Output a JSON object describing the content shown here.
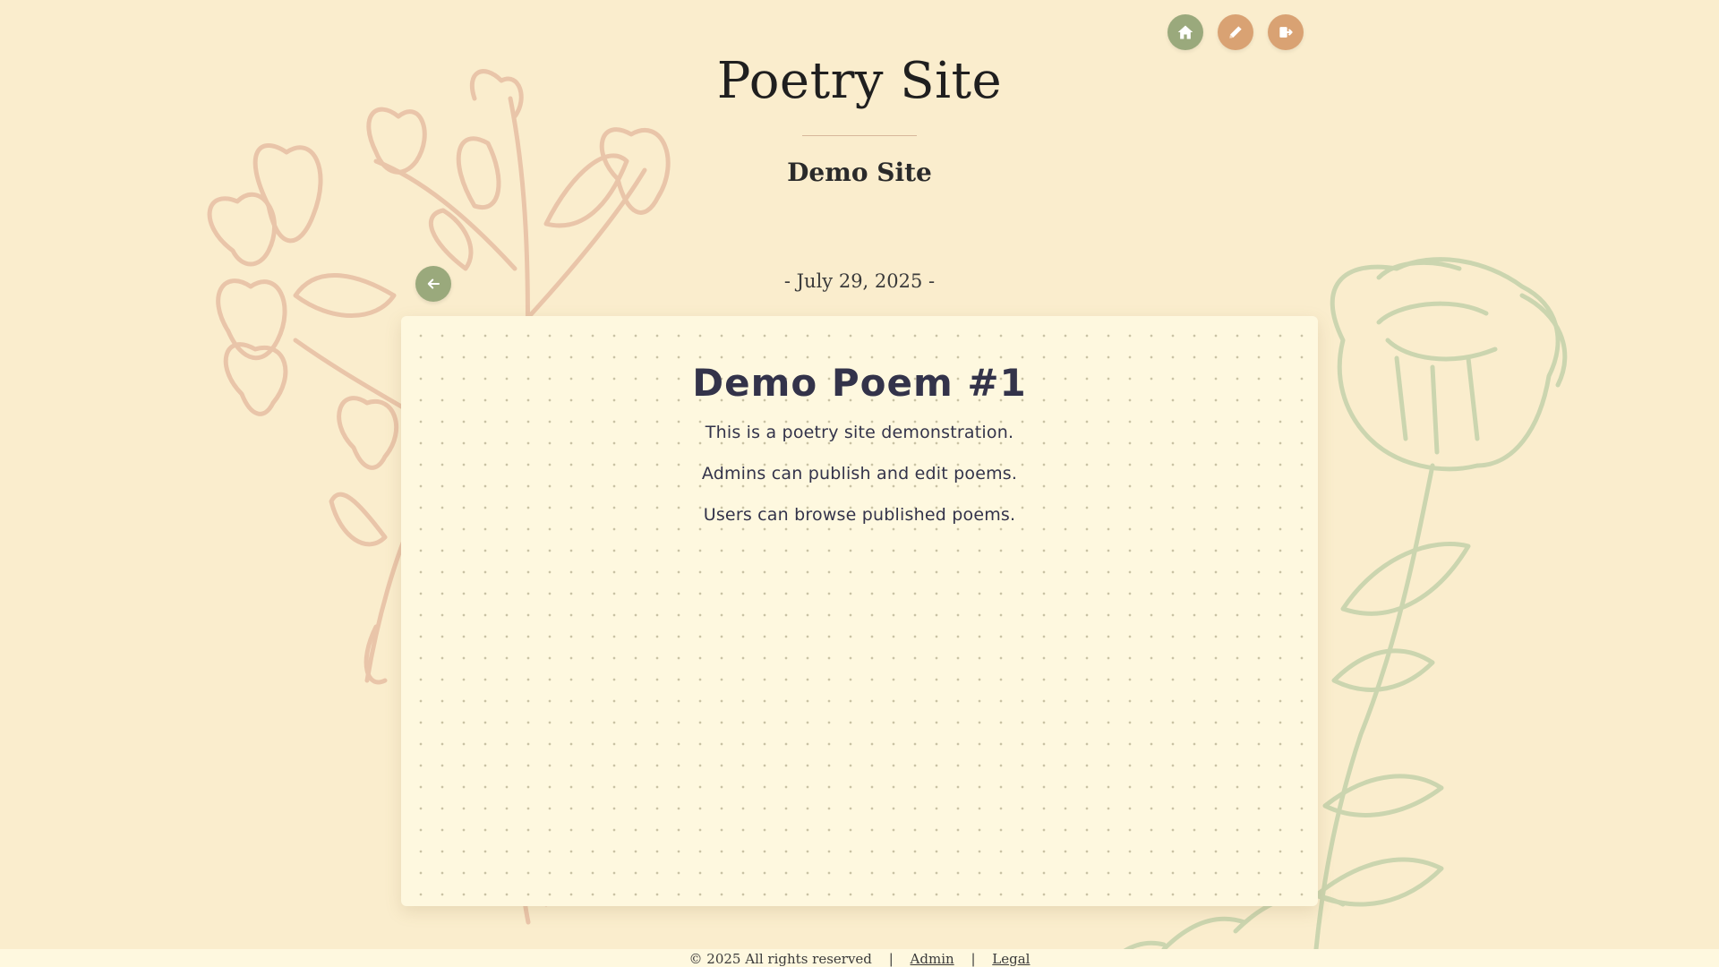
{
  "nav": {
    "home_icon": "home-icon",
    "edit_icon": "pencil-icon",
    "logout_icon": "logout-icon",
    "colors": {
      "home": "#9aa97c",
      "edit": "#d9a273",
      "logout": "#d9a273"
    }
  },
  "header": {
    "title": "Poetry Site",
    "subtitle": "Demo Site"
  },
  "poem_view": {
    "back_icon": "arrow-left-icon",
    "date": "- July 29, 2025 -",
    "title": "Demo Poem #1",
    "lines": [
      "This is a poetry site demonstration.",
      "Admins can publish and edit poems.",
      "Users can browse published poems."
    ]
  },
  "footer": {
    "copyright": "© 2025 All rights reserved",
    "separator": "|",
    "admin_link": "Admin",
    "legal_link": "Legal"
  },
  "colors": {
    "background": "#faedcd",
    "card": "#fef8df",
    "flower_pink": "#e9c3a8",
    "flower_green": "#c9d4ae"
  }
}
